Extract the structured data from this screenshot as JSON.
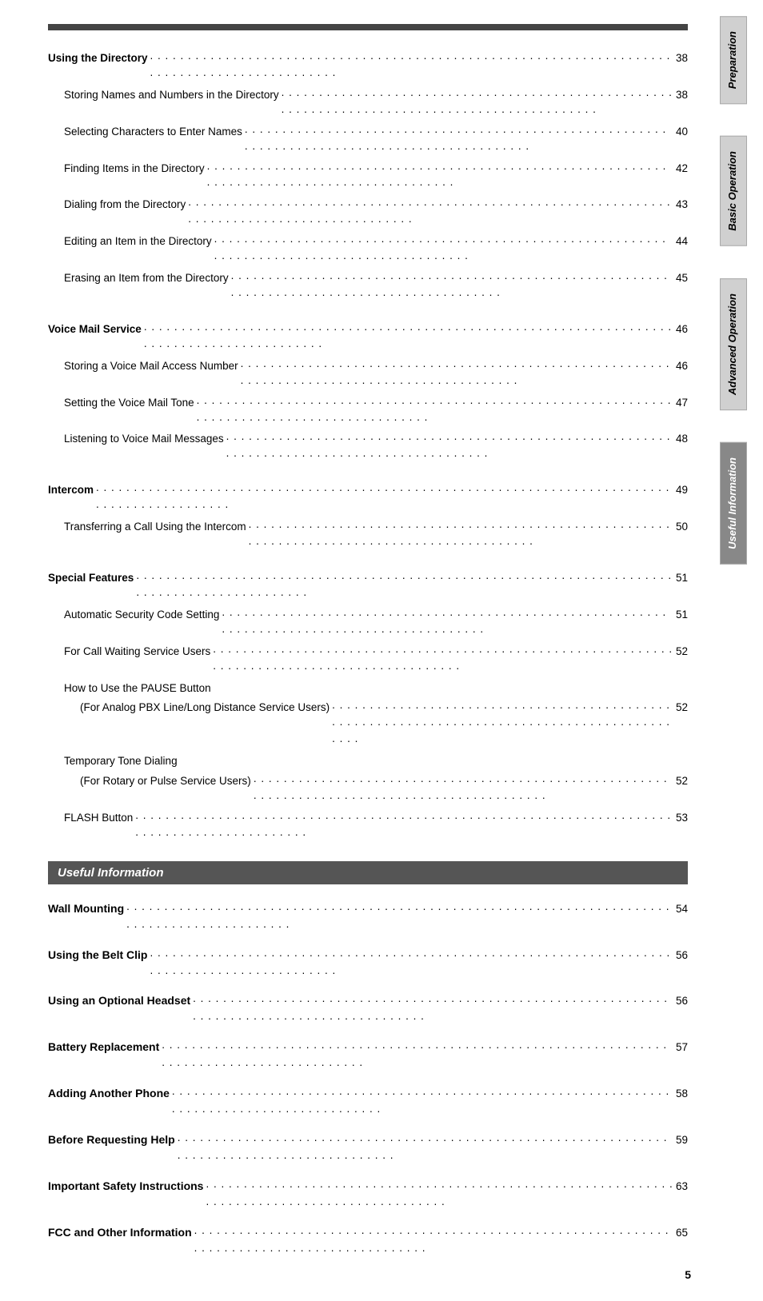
{
  "page": {
    "page_number": "5",
    "top_bar": true
  },
  "sidebar": {
    "tabs": [
      {
        "id": "preparation",
        "label": "Preparation"
      },
      {
        "id": "basic-operation",
        "label": "Basic Operation"
      },
      {
        "id": "advanced-operation",
        "label": "Advanced Operation"
      },
      {
        "id": "useful-information",
        "label": "Useful Information",
        "active": true
      }
    ]
  },
  "sections": [
    {
      "id": "directory-section",
      "entries": [
        {
          "id": "using-directory",
          "type": "main",
          "title": "Using the Directory",
          "dots": true,
          "page": "38"
        },
        {
          "id": "storing-names",
          "type": "sub",
          "title": "Storing Names and Numbers in the Directory",
          "dots": true,
          "page": "38"
        },
        {
          "id": "selecting-chars",
          "type": "sub",
          "title": "Selecting Characters to Enter Names",
          "dots": true,
          "page": "40"
        },
        {
          "id": "finding-items",
          "type": "sub",
          "title": "Finding Items in the Directory",
          "dots": true,
          "page": "42"
        },
        {
          "id": "dialing-directory",
          "type": "sub",
          "title": "Dialing from the Directory",
          "dots": true,
          "page": "43"
        },
        {
          "id": "editing-item",
          "type": "sub",
          "title": "Editing an Item in the Directory",
          "dots": true,
          "page": "44"
        },
        {
          "id": "erasing-item",
          "type": "sub",
          "title": "Erasing an Item from the Directory",
          "dots": true,
          "page": "45"
        }
      ]
    },
    {
      "id": "voicemail-section",
      "entries": [
        {
          "id": "voice-mail",
          "type": "main",
          "title": "Voice Mail Service",
          "dots": true,
          "page": "46"
        },
        {
          "id": "storing-voicemail",
          "type": "sub",
          "title": "Storing a Voice Mail Access Number",
          "dots": true,
          "page": "46"
        },
        {
          "id": "setting-voicemail-tone",
          "type": "sub",
          "title": "Setting the Voice Mail Tone",
          "dots": true,
          "page": "47"
        },
        {
          "id": "listening-voicemail",
          "type": "sub",
          "title": "Listening to Voice Mail Messages",
          "dots": true,
          "page": "48"
        }
      ]
    },
    {
      "id": "intercom-section",
      "entries": [
        {
          "id": "intercom",
          "type": "main",
          "title": "Intercom",
          "dots": true,
          "page": "49"
        },
        {
          "id": "transferring-call",
          "type": "sub",
          "title": "Transferring a Call Using the Intercom",
          "dots": true,
          "page": "50"
        }
      ]
    },
    {
      "id": "special-features-section",
      "entries": [
        {
          "id": "special-features",
          "type": "main",
          "title": "Special Features",
          "dots": true,
          "page": "51"
        },
        {
          "id": "auto-security",
          "type": "sub",
          "title": "Automatic Security Code Setting",
          "dots": true,
          "page": "51"
        },
        {
          "id": "call-waiting",
          "type": "sub",
          "title": "For Call Waiting Service Users",
          "dots": true,
          "page": "52"
        },
        {
          "id": "pause-button-header",
          "type": "sub-nopage",
          "title": "How to Use the PAUSE Button",
          "dots": false,
          "page": ""
        },
        {
          "id": "analog-pbx",
          "type": "sub-sub",
          "title": "(For Analog PBX Line/Long Distance Service Users)",
          "dots": true,
          "page": "52"
        },
        {
          "id": "temp-tone-header",
          "type": "sub-nopage",
          "title": "Temporary Tone Dialing",
          "dots": false,
          "page": ""
        },
        {
          "id": "rotary-pulse",
          "type": "sub-sub",
          "title": "(For Rotary or Pulse Service Users)",
          "dots": true,
          "page": "52"
        },
        {
          "id": "flash-button",
          "type": "sub",
          "title": "FLASH Button",
          "dots": true,
          "page": "53"
        }
      ]
    }
  ],
  "useful_section": {
    "header": "Useful Information",
    "entries": [
      {
        "id": "wall-mounting",
        "title": "Wall Mounting",
        "dots": true,
        "page": "54"
      },
      {
        "id": "belt-clip",
        "title": "Using the Belt Clip",
        "dots": true,
        "page": "56"
      },
      {
        "id": "optional-headset",
        "title": "Using an Optional Headset",
        "dots": true,
        "page": "56"
      },
      {
        "id": "battery-replacement",
        "title": "Battery Replacement",
        "dots": true,
        "page": "57"
      },
      {
        "id": "adding-another-phone",
        "title": "Adding Another Phone",
        "dots": true,
        "page": "58"
      },
      {
        "id": "before-requesting-help",
        "title": "Before Requesting Help",
        "dots": true,
        "page": "59"
      },
      {
        "id": "safety-instructions",
        "title": "Important Safety Instructions",
        "dots": true,
        "page": "63"
      },
      {
        "id": "fcc-info",
        "title": "FCC and Other Information",
        "dots": true,
        "page": "65"
      }
    ]
  }
}
